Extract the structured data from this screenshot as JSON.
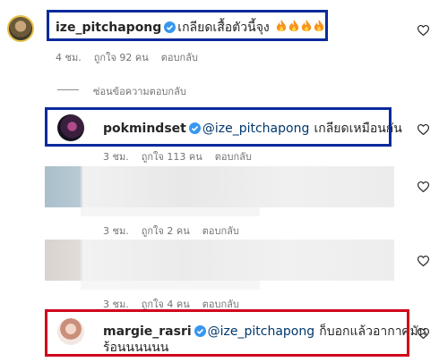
{
  "colors": {
    "highlight_blue": "#0a2a9c",
    "highlight_red": "#d0021b",
    "verified": "#3797f0",
    "meta_text": "#737373",
    "mention": "#00376b"
  },
  "comments": [
    {
      "username": "ize_pitchapong",
      "verified": true,
      "text": "เกลียดเสื้อตัวนี้จุง",
      "emojis": [
        "fire-emoji",
        "fire-emoji",
        "fire-emoji",
        "fire-emoji"
      ],
      "time": "4 ชม.",
      "likes": "ถูกใจ 92 คน",
      "reply": "ตอบกลับ"
    }
  ],
  "hide_replies": "ซ่อนข้อความตอบกลับ",
  "replies": [
    {
      "username": "pokmindset",
      "verified": true,
      "mention": "@ize_pitchapong",
      "text": "เกลียดเหมือนกัน",
      "time": "3 ชม.",
      "likes": "ถูกใจ 113 คน",
      "reply": "ตอบกลับ"
    },
    {
      "time": "3 ชม.",
      "likes": "ถูกใจ 2 คน",
      "reply": "ตอบกลับ"
    },
    {
      "time": "3 ชม.",
      "likes": "ถูกใจ 4 คน",
      "reply": "ตอบกลับ"
    },
    {
      "username": "margie_rasri",
      "verified": true,
      "mention": "@ize_pitchapong",
      "text_line1": "ก็บอกแล้วอากาศมัน",
      "text_line2": "ร้อนนนนนน"
    }
  ]
}
